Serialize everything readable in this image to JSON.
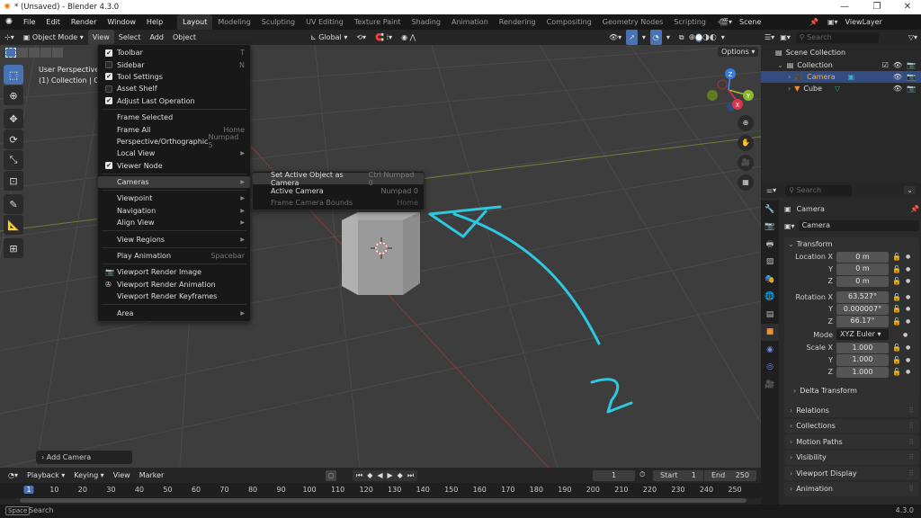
{
  "window": {
    "title": "* (Unsaved) - Blender 4.3.0",
    "minimize": "—",
    "maximize": "❐",
    "close": "✕"
  },
  "menubar": {
    "menus": [
      "File",
      "Edit",
      "Render",
      "Window",
      "Help"
    ],
    "workspaces": [
      "Layout",
      "Modeling",
      "Sculpting",
      "UV Editing",
      "Texture Paint",
      "Shading",
      "Animation",
      "Rendering",
      "Compositing",
      "Geometry Nodes",
      "Scripting"
    ],
    "active_workspace": "Layout",
    "add_workspace": "+",
    "scene": "Scene",
    "view_layer": "ViewLayer"
  },
  "viewport_header": {
    "mode": "Object Mode",
    "menus": [
      "View",
      "Select",
      "Add",
      "Object"
    ],
    "active_menu": "View",
    "orientation": "Global",
    "options": "Options"
  },
  "viewport": {
    "view_name": "User Perspective",
    "collection_info": "(1) Collection | Camera",
    "annotation_text": "2",
    "annotation_color": "#2ec8e0",
    "last_operator": "Add Camera",
    "gizmo": {
      "x": "X",
      "y": "Y",
      "z": "Z"
    }
  },
  "view_menu": {
    "items": [
      {
        "label": "Toolbar",
        "check": true,
        "shortcut": "T"
      },
      {
        "label": "Sidebar",
        "check": false,
        "shortcut": "N"
      },
      {
        "label": "Tool Settings",
        "check": true,
        "shortcut": ""
      },
      {
        "label": "Asset Shelf",
        "check": false,
        "shortcut": ""
      },
      {
        "label": "Adjust Last Operation",
        "check": true,
        "shortcut": ""
      },
      {
        "label": "Frame Selected",
        "shortcut": ""
      },
      {
        "label": "Frame All",
        "shortcut": "Home"
      },
      {
        "label": "Perspective/Orthographic",
        "shortcut": "Numpad 5"
      },
      {
        "label": "Local View",
        "submenu": true
      },
      {
        "label": "Viewer Node",
        "check": true
      },
      {
        "label": "Cameras",
        "submenu": true,
        "highlighted": true
      },
      {
        "label": "Viewpoint",
        "submenu": true
      },
      {
        "label": "Navigation",
        "submenu": true
      },
      {
        "label": "Align View",
        "submenu": true
      },
      {
        "label": "View Regions",
        "submenu": true
      },
      {
        "label": "Play Animation",
        "shortcut": "Spacebar"
      },
      {
        "label": "Viewport Render Image",
        "icon": "render-image-icon"
      },
      {
        "label": "Viewport Render Animation",
        "icon": "render-animation-icon"
      },
      {
        "label": "Viewport Render Keyframes"
      },
      {
        "label": "Area",
        "submenu": true
      }
    ]
  },
  "cameras_submenu": {
    "items": [
      {
        "label": "Set Active Object as Camera",
        "shortcut": "Ctrl Numpad 0",
        "highlighted": true
      },
      {
        "label": "Active Camera",
        "shortcut": "Numpad 0"
      },
      {
        "label": "Frame Camera Bounds",
        "shortcut": "Home",
        "disabled": true
      }
    ]
  },
  "outliner": {
    "search_placeholder": "Search",
    "rows": [
      {
        "label": "Scene Collection"
      },
      {
        "label": "Collection"
      },
      {
        "label": "Camera",
        "selected": true
      },
      {
        "label": "Cube"
      }
    ]
  },
  "properties": {
    "search_placeholder": "Search",
    "object_name": "Camera",
    "datablock_name": "Camera",
    "transform_title": "Transform",
    "location": {
      "label": "Location X",
      "x": "0 m",
      "y": "0 m",
      "z": "0 m"
    },
    "rotation": {
      "label": "Rotation X",
      "x": "63.527°",
      "y": "0.000007°",
      "z": "66.17°"
    },
    "mode_label": "Mode",
    "mode_value": "XYZ Euler",
    "scale": {
      "label": "Scale X",
      "x": "1.000",
      "y": "1.000",
      "z": "1.000"
    },
    "axis_y": "Y",
    "axis_z": "Z",
    "delta_transform": "Delta Transform",
    "panels": [
      "Relations",
      "Collections",
      "Motion Paths",
      "Visibility",
      "Viewport Display",
      "Animation"
    ]
  },
  "timeline": {
    "menus": [
      "Playback",
      "Keying",
      "View",
      "Marker"
    ],
    "current_frame": "1",
    "start_label": "Start",
    "start": "1",
    "end_label": "End",
    "end": "250",
    "ticks": [
      "1",
      "10",
      "20",
      "30",
      "40",
      "50",
      "60",
      "70",
      "80",
      "90",
      "100",
      "110",
      "120",
      "130",
      "140",
      "150",
      "160",
      "170",
      "180",
      "190",
      "200",
      "210",
      "220",
      "230",
      "240",
      "250"
    ]
  },
  "statusbar": {
    "key": "Space",
    "hint": "Search",
    "version": "4.3.0"
  }
}
